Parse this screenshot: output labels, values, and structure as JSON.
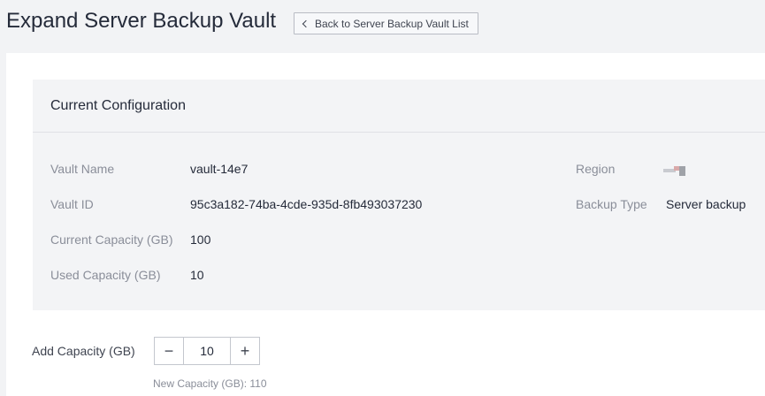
{
  "header": {
    "title": "Expand Server Backup Vault",
    "back_button_label": "Back to Server Backup Vault List"
  },
  "config": {
    "title": "Current Configuration",
    "vault_name_label": "Vault Name",
    "vault_name": "vault-14e7",
    "vault_id_label": "Vault ID",
    "vault_id": "95c3a182-74ba-4cde-935d-8fb493037230",
    "current_capacity_label": "Current Capacity (GB)",
    "current_capacity": "100",
    "used_capacity_label": "Used Capacity (GB)",
    "used_capacity": "10",
    "region_label": "Region",
    "region_icon": "region-flag-icon",
    "backup_type_label": "Backup Type",
    "backup_type": "Server backup"
  },
  "expand": {
    "add_capacity_label": "Add Capacity (GB)",
    "add_capacity_value": "10",
    "minus_symbol": "−",
    "plus_symbol": "+",
    "new_capacity_text": "New Capacity (GB): 110"
  }
}
